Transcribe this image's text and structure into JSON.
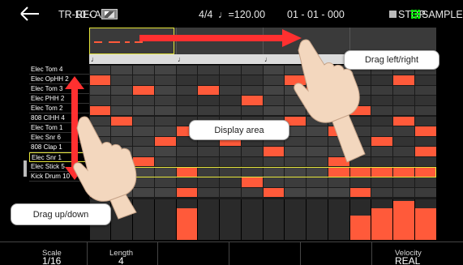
{
  "header": {
    "back_icon": "arrow-left-icon",
    "mode": "TR-REC",
    "kit": "10 - A",
    "time_signature": "4/4",
    "tempo": "♩=120.00",
    "position": "01 - 01 - 000",
    "transport": "STOP",
    "pad_mode": "SAMPLE PAD",
    "pad_icon_color": "#00ff00"
  },
  "ruler": {
    "beats": [
      "♩",
      "♩",
      "♩",
      "♩"
    ]
  },
  "instruments": [
    "Elec Tom 4",
    "Elec OpHH 2",
    "Elec Tom 3",
    "Elec PHH 2",
    "Elec Tom 2",
    "808 CIHH 4",
    "Elec Tom 1",
    "Elec Snr 6",
    "808 Clap 1",
    "Elec Snr 1",
    "Elec Stick 5",
    "Kick Drum 10"
  ],
  "selected_instrument_index": 9,
  "grid": {
    "steps": 16,
    "rows": 13,
    "hits": [
      [
        1,
        0
      ],
      [
        1,
        9
      ],
      [
        1,
        14
      ],
      [
        2,
        2
      ],
      [
        2,
        5
      ],
      [
        2,
        10
      ],
      [
        3,
        7
      ],
      [
        4,
        0
      ],
      [
        4,
        12
      ],
      [
        5,
        1
      ],
      [
        5,
        9
      ],
      [
        5,
        14
      ],
      [
        6,
        4
      ],
      [
        6,
        11
      ],
      [
        6,
        15
      ],
      [
        7,
        3
      ],
      [
        7,
        6
      ],
      [
        7,
        13
      ],
      [
        8,
        8
      ],
      [
        8,
        15
      ],
      [
        9,
        2
      ],
      [
        9,
        11
      ],
      [
        10,
        4
      ],
      [
        10,
        11
      ],
      [
        10,
        12
      ],
      [
        10,
        13
      ],
      [
        10,
        14
      ],
      [
        10,
        15
      ],
      [
        11,
        1
      ],
      [
        11,
        7
      ],
      [
        12,
        0
      ],
      [
        12,
        4
      ],
      [
        12,
        8
      ],
      [
        12,
        12
      ]
    ],
    "hit_color": "#ff5a3a",
    "selected_row_color": "#e5e53a"
  },
  "velocity": {
    "bars": [
      0,
      0,
      0,
      0,
      0.78,
      0,
      0,
      0,
      0,
      0,
      0,
      0,
      0.6,
      0.78,
      0.96,
      0.78
    ]
  },
  "footer": {
    "scale_label": "Scale",
    "scale_value": "1/16",
    "length_label": "Length",
    "length_value": "4",
    "velocity_label": "Velocity",
    "velocity_value": "REAL"
  },
  "callouts": {
    "drag_lr": "Drag left/right",
    "display_area": "Display area",
    "drag_ud": "Drag up/down"
  }
}
